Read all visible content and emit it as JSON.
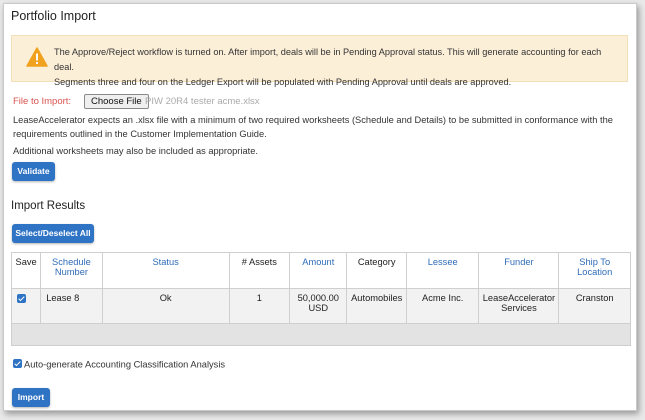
{
  "page": {
    "title": "Portfolio Import"
  },
  "alert": {
    "icon": "warning-icon",
    "line1": "The Approve/Reject workflow is turned on. After import, deals will be in Pending Approval status. This will generate accounting for each deal.",
    "line2": "Segments three and four on the Ledger Export will be populated with Pending Approval until deals are approved."
  },
  "file": {
    "label": "File to Import:",
    "choose_label": "Choose File",
    "file_name": "PIW 20R4 tester acme.xlsx"
  },
  "description": {
    "line1": "LeaseAccelerator expects an .xlsx file with a minimum of two required worksheets (Schedule and Details) to be submitted in conformance with the",
    "line2": "requirements outlined in the Customer Implementation Guide.",
    "line3": "Additional worksheets may also be included as appropriate."
  },
  "buttons": {
    "validate": "Validate",
    "select_deselect": "Select/Deselect All",
    "import": "Import"
  },
  "results": {
    "title": "Import Results",
    "columns": {
      "save": "Save",
      "schedule_number": "Schedule Number",
      "status": "Status",
      "assets": "# Assets",
      "amount": "Amount",
      "category": "Category",
      "lessee": "Lessee",
      "funder": "Funder",
      "ship_to": "Ship To Location"
    },
    "rows": [
      {
        "save_checked": true,
        "schedule_number": "Lease 8",
        "status": "Ok",
        "assets": "1",
        "amount": "50,000.00 USD",
        "category": "Automobiles",
        "lessee": "Acme Inc.",
        "funder": "LeaseAccelerator Services",
        "ship_to": "Cranston"
      }
    ]
  },
  "auto_generate": {
    "checked": true,
    "label": "Auto-generate Accounting Classification Analysis"
  },
  "colors": {
    "accent": "#2f73c5",
    "link": "#2f6cb7",
    "required": "#d9534f",
    "alert_bg": "#fcefd8",
    "warning": "#f0a21e"
  }
}
